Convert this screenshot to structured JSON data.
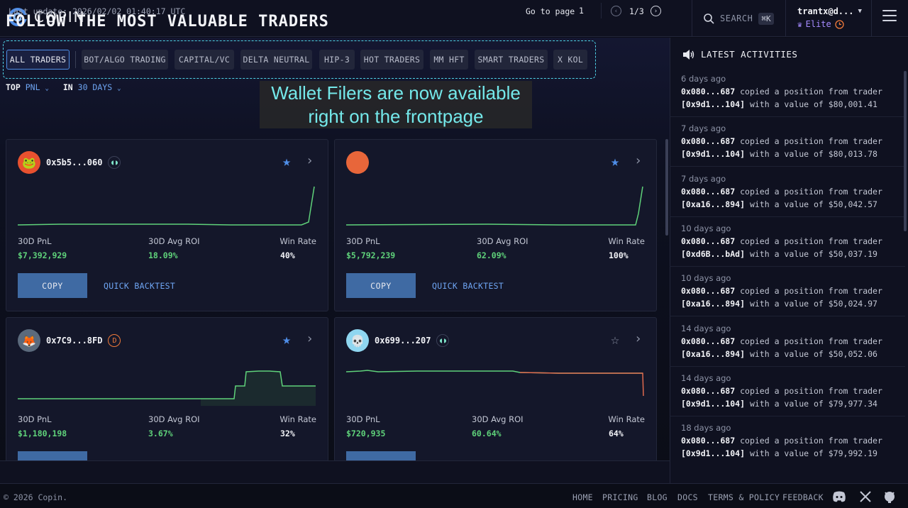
{
  "header": {
    "logo_text": "COPIN",
    "search_label": "SEARCH",
    "search_shortcut": "⌘K",
    "user_name": "trantx@d...",
    "user_tier": "Elite"
  },
  "main": {
    "title": "FOLLOW THE MOST VALUABLE TRADERS",
    "filters": [
      "ALL TRADERS",
      "BOT/ALGO TRADING",
      "CAPITAL/VC",
      "DELTA NEUTRAL",
      "HIP-3",
      "HOT TRADERS",
      "MM HFT",
      "SMART TRADERS",
      "X KOL"
    ],
    "active_filter": "ALL TRADERS",
    "sort_top_label": "TOP",
    "sort_top_value": "PNL",
    "sort_in_label": "IN",
    "sort_in_value": "30 DAYS",
    "banner": "Wallet Filers are now available right on the frontpage",
    "banner_line1": "Wallet Filers are now available",
    "banner_line2": "right on the frontpage"
  },
  "labels": {
    "pnl": "30D PnL",
    "roi": "30D Avg ROI",
    "win": "Win Rate",
    "copy": "COPY",
    "backtest": "QUICK BACKTEST"
  },
  "cards": [
    {
      "address": "0x5b5...060",
      "pnl": "$7,392,929",
      "roi": "18.09%",
      "win_rate": "40%",
      "favorited": true,
      "avatar_icon": "frog-avatar-icon"
    },
    {
      "address": "",
      "pnl": "$5,792,239",
      "roi": "62.09%",
      "win_rate": "100%",
      "favorited": true,
      "avatar_icon": "orange-avatar-icon"
    },
    {
      "address": "0x7C9...8FD",
      "pnl": "$1,180,198",
      "roi": "3.67%",
      "win_rate": "32%",
      "favorited": true,
      "avatar_icon": "fox-avatar-icon"
    },
    {
      "address": "0x699...207",
      "pnl": "$720,935",
      "roi": "60.64%",
      "win_rate": "64%",
      "favorited": false,
      "avatar_icon": "skull-avatar-icon"
    }
  ],
  "pager": {
    "last_update": "Last update: 2026/02/02 01:40:17 UTC",
    "goto_label": "Go to page",
    "goto_value": "1",
    "page_count": "1/3"
  },
  "sidebar": {
    "title": "LATEST ACTIVITIES",
    "activities": [
      {
        "time": "6 days ago",
        "copier": "0x080...687",
        "trader": "[0x9d1...104]",
        "value": "$80,001.41"
      },
      {
        "time": "7 days ago",
        "copier": "0x080...687",
        "trader": "[0x9d1...104]",
        "value": "$80,013.78"
      },
      {
        "time": "7 days ago",
        "copier": "0x080...687",
        "trader": "[0xa16...894]",
        "value": "$50,042.57"
      },
      {
        "time": "10 days ago",
        "copier": "0x080...687",
        "trader": "[0xd6B...bAd]",
        "value": "$50,037.19"
      },
      {
        "time": "10 days ago",
        "copier": "0x080...687",
        "trader": "[0xa16...894]",
        "value": "$50,024.97"
      },
      {
        "time": "14 days ago",
        "copier": "0x080...687",
        "trader": "[0xa16...894]",
        "value": "$50,052.06"
      },
      {
        "time": "14 days ago",
        "copier": "0x080...687",
        "trader": "[0x9d1...104]",
        "value": "$79,977.34"
      },
      {
        "time": "18 days ago",
        "copier": "0x080...687",
        "trader": "[0x9d1...104]",
        "value": "$79,992.19"
      }
    ],
    "copied_text": "copied a position from trader",
    "with_value_text": "with a value of"
  },
  "footer": {
    "copyright": "© 2026 Copin.",
    "links": [
      "HOME",
      "PRICING",
      "BLOG",
      "DOCS",
      "TERMS & POLICY",
      "FEEDBACK"
    ]
  },
  "colors": {
    "accent": "#6ea4f2",
    "profit": "#5fd27a",
    "loss": "#e06a4e",
    "favorite": "#4f8ee8",
    "banner_text": "#74e8ea"
  }
}
